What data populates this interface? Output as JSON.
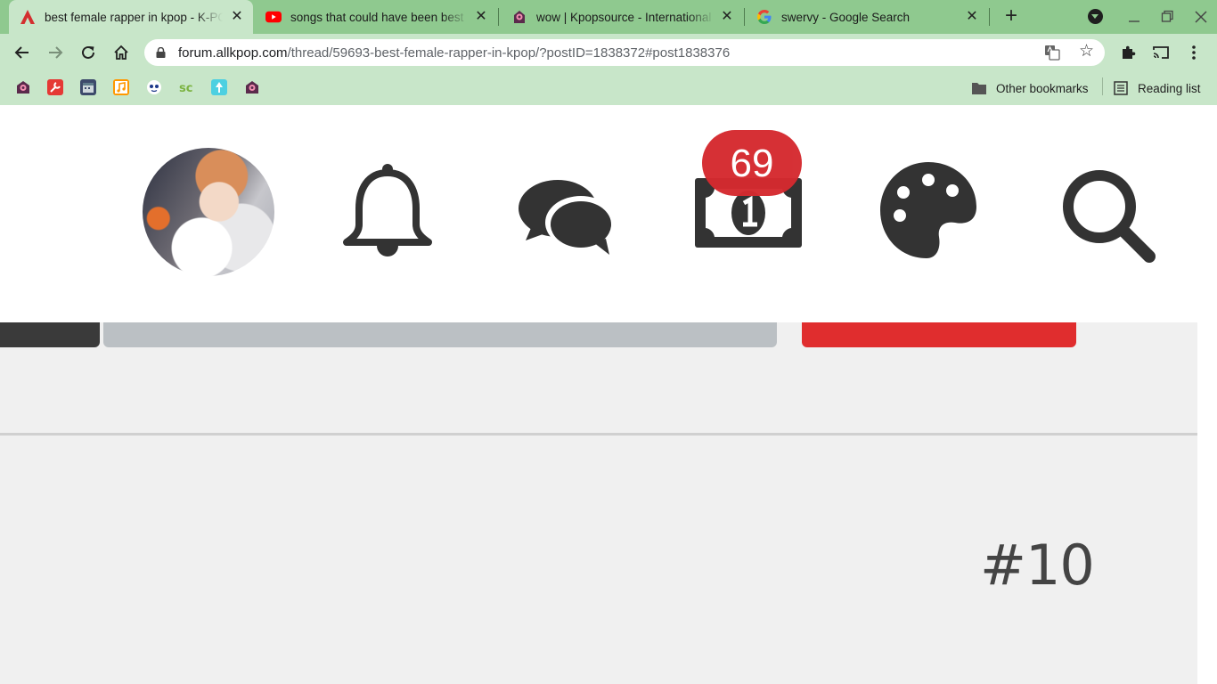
{
  "browser": {
    "tabs": [
      {
        "title": "best female rapper in kpop - K-POP",
        "icon": "allkpop-icon",
        "active": true
      },
      {
        "title": "songs that could have been best",
        "icon": "youtube-icon",
        "active": false
      },
      {
        "title": "wow | Kpopsource - International",
        "icon": "kpopsource-icon",
        "active": false
      },
      {
        "title": "swervy - Google Search",
        "icon": "google-icon",
        "active": false
      }
    ],
    "close_glyph": "✕",
    "new_tab_glyph": "+",
    "address": {
      "host": "forum.allkpop.com",
      "path": "/thread/59693-best-female-rapper-in-kpop/?postID=1838372#post1838376"
    },
    "bookmarks_right": {
      "other_bookmarks": "Other bookmarks",
      "reading_list": "Reading list"
    }
  },
  "page": {
    "header": {
      "notification_badge": "69"
    },
    "post_number": "#10"
  },
  "colors": {
    "tabstrip": "#8fc98f",
    "toolbar": "#c8e6c9",
    "accent_red": "#e02d2e",
    "icon_dark": "#333333"
  }
}
